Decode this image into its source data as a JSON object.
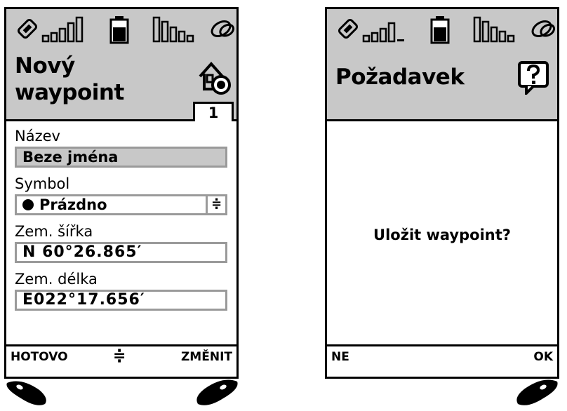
{
  "screens": {
    "left": {
      "title": "Nový\nwaypoint",
      "page_tab": "1",
      "fields": [
        {
          "label": "Název",
          "value": "Beze jména"
        },
        {
          "label": "Symbol",
          "value": "Prázdno"
        },
        {
          "label": "Zem. šířka",
          "value": "N 60°26.865′"
        },
        {
          "label": "Zem. délka",
          "value": "E022°17.656′"
        }
      ],
      "softkeys": {
        "left": "HOTOVO",
        "middle": "≑",
        "right": "ZMĚNIT"
      },
      "header_icon": "home-gps-icon"
    },
    "right": {
      "title": "Požadavek",
      "question": "Uložit waypoint?",
      "softkeys": {
        "left": "NE",
        "right": "OK"
      },
      "header_icon": "help-speech-icon"
    }
  },
  "colors": {
    "header_bg": "#c8c8c8",
    "field_border": "#9a9a9a",
    "border": "#000000"
  },
  "icons": [
    "signal-icon",
    "battery-icon",
    "gps-signal-icon",
    "satellite-icon",
    "nav-key-left-icon",
    "nav-key-right-icon"
  ]
}
